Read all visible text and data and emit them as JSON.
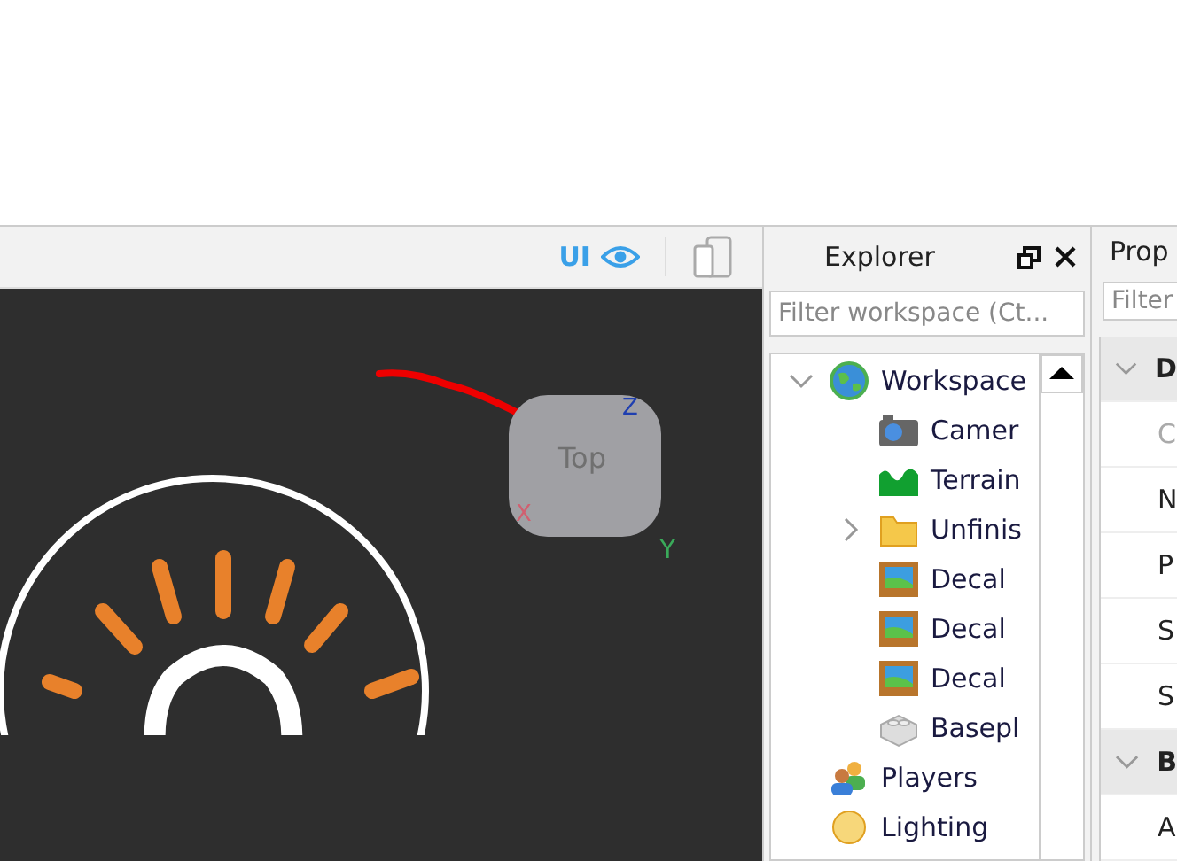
{
  "viewport_toolbar": {
    "ui_label": "UI"
  },
  "viewport": {
    "gizmo": {
      "face": "Top",
      "axes": [
        "X",
        "Y",
        "Z"
      ]
    }
  },
  "explorer": {
    "title": "Explorer",
    "filter": {
      "placeholder": "Filter workspace (Ct..."
    },
    "tree": [
      {
        "label": "Workspace",
        "kind": "globe",
        "expanded": true,
        "children": [
          {
            "label": "Camer",
            "kind": "camera"
          },
          {
            "label": "Terrain",
            "kind": "terrain"
          },
          {
            "label": "Unfinis",
            "kind": "folder",
            "expanded": false
          },
          {
            "label": "Decal",
            "kind": "decal"
          },
          {
            "label": "Decal",
            "kind": "decal"
          },
          {
            "label": "Decal",
            "kind": "decal"
          },
          {
            "label": "Basepl",
            "kind": "brick"
          }
        ]
      },
      {
        "label": "Players",
        "kind": "players"
      },
      {
        "label": "Lighting",
        "kind": "lighting"
      }
    ]
  },
  "properties": {
    "title": "Prop",
    "filter": {
      "placeholder": "Filter"
    },
    "rows": [
      {
        "kind": "section",
        "label": "D",
        "expanded": true
      },
      {
        "kind": "row",
        "label": "C",
        "disabled": true
      },
      {
        "kind": "row",
        "label": "N",
        "disabled": false
      },
      {
        "kind": "row",
        "label": "P",
        "disabled": false
      },
      {
        "kind": "row",
        "label": "S",
        "disabled": false
      },
      {
        "kind": "row",
        "label": "S",
        "disabled": false
      },
      {
        "kind": "section",
        "label": "B",
        "expanded": true
      },
      {
        "kind": "row",
        "label": "A",
        "disabled": false
      }
    ]
  }
}
